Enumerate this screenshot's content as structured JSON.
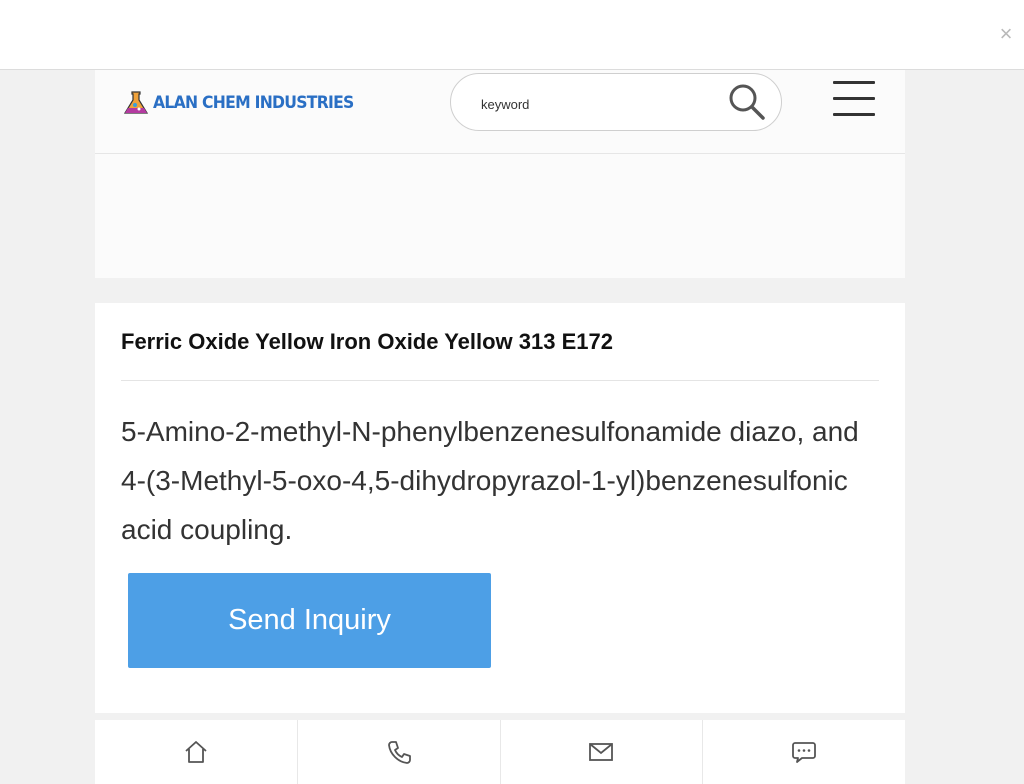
{
  "close_symbol": "×",
  "header": {
    "logo_text": "ALAN CHEM INDUSTRIES",
    "search_placeholder": "keyword"
  },
  "product": {
    "title": "Ferric Oxide Yellow Iron Oxide Yellow 313 E172",
    "description": "5-Amino-2-methyl-N-phenylbenzenesulfonamide diazo, and 4-(3-Methyl-5-oxo-4,5-dihydropyrazol-1-yl)benzenesulfonic acid coupling.",
    "inquiry_label": "Send Inquiry"
  },
  "bottom_nav": [
    {
      "icon": "home-icon"
    },
    {
      "icon": "phone-icon"
    },
    {
      "icon": "mail-icon"
    },
    {
      "icon": "chat-icon"
    }
  ],
  "colors": {
    "brand": "#2a6fc4",
    "button": "#4d9fe6",
    "page_bg": "#f1f1f1"
  }
}
